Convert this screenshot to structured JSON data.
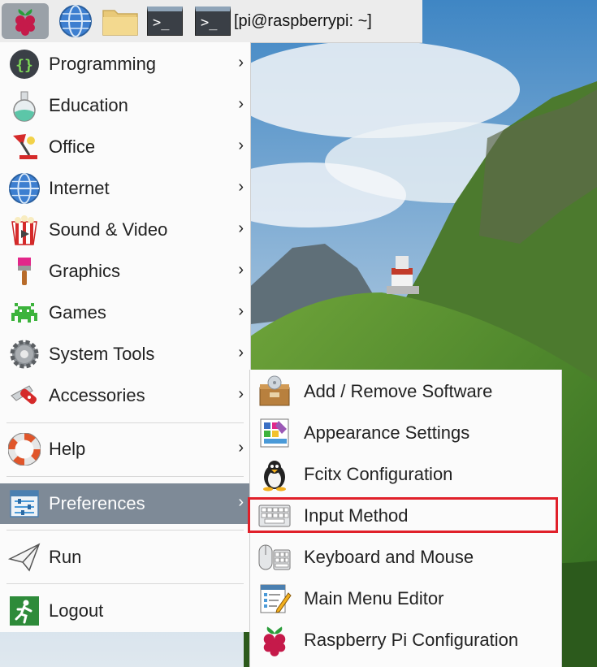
{
  "taskbar": {
    "menu_icon": "raspberry-icon",
    "browser_icon": "globe-icon",
    "files_icon": "folder-icon",
    "terminal_icon": "terminal-icon",
    "task_label": "[pi@raspberrypi: ~]"
  },
  "main_menu": {
    "items": [
      {
        "label": "Programming",
        "icon": "programming-icon",
        "has_submenu": true
      },
      {
        "label": "Education",
        "icon": "education-flask-icon",
        "has_submenu": true
      },
      {
        "label": "Office",
        "icon": "office-lamp-icon",
        "has_submenu": true
      },
      {
        "label": "Internet",
        "icon": "globe-icon",
        "has_submenu": true
      },
      {
        "label": "Sound & Video",
        "icon": "popcorn-icon",
        "has_submenu": true
      },
      {
        "label": "Graphics",
        "icon": "paintbrush-icon",
        "has_submenu": true
      },
      {
        "label": "Games",
        "icon": "space-invader-icon",
        "has_submenu": true
      },
      {
        "label": "System Tools",
        "icon": "gear-icon",
        "has_submenu": true
      },
      {
        "label": "Accessories",
        "icon": "pocket-knife-icon",
        "has_submenu": true
      },
      {
        "label": "Help",
        "icon": "lifebuoy-icon",
        "has_submenu": true
      },
      {
        "label": "Preferences",
        "icon": "preferences-sliders-icon",
        "has_submenu": true,
        "active": true
      },
      {
        "label": "Run",
        "icon": "paper-plane-icon",
        "has_submenu": false
      },
      {
        "label": "Logout",
        "icon": "exit-runner-icon",
        "has_submenu": false
      }
    ],
    "chevron": "›"
  },
  "submenu": {
    "items": [
      {
        "label": "Add / Remove Software",
        "icon": "software-box-icon"
      },
      {
        "label": "Appearance Settings",
        "icon": "appearance-palette-icon"
      },
      {
        "label": "Fcitx Configuration",
        "icon": "penguin-icon"
      },
      {
        "label": "Input Method",
        "icon": "keyboard-icon",
        "highlighted": true
      },
      {
        "label": "Keyboard and Mouse",
        "icon": "keyboard-mouse-icon"
      },
      {
        "label": "Main Menu Editor",
        "icon": "menu-editor-icon"
      },
      {
        "label": "Raspberry Pi Configuration",
        "icon": "raspberry-icon"
      }
    ]
  },
  "colors": {
    "active_item_bg": "#7e8a97",
    "highlight_border": "#e0202a",
    "menu_bg": "#fbfbfb"
  }
}
